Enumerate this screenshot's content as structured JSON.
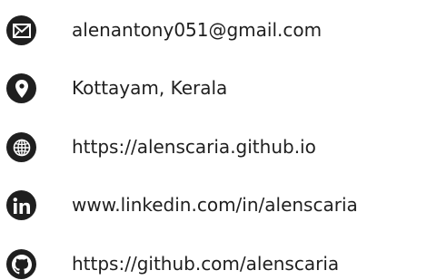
{
  "contacts": [
    {
      "icon": "email-icon",
      "text": "alenantony051@gmail.com"
    },
    {
      "icon": "location-pin-icon",
      "text": "Kottayam, Kerala"
    },
    {
      "icon": "globe-icon",
      "text": "https://alenscaria.github.io"
    },
    {
      "icon": "linkedin-icon",
      "text": "www.linkedin.com/in/alenscaria"
    },
    {
      "icon": "github-icon",
      "text": "https://github.com/alenscaria"
    }
  ],
  "colors": {
    "icon_background": "#1f1f1f",
    "icon_foreground": "#ffffff",
    "text": "#1f1f1f"
  }
}
